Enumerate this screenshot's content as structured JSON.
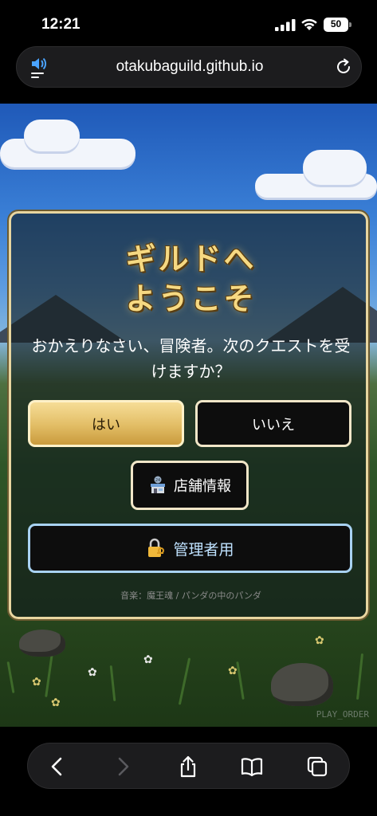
{
  "status_bar": {
    "time": "12:21",
    "battery": "50"
  },
  "browser": {
    "url": "otakubaguild.github.io"
  },
  "game": {
    "title_line1": "ギルドへ",
    "title_line2": "ようこそ",
    "prompt": "おかえりなさい、冒険者。次のクエストを受けますか？",
    "yes_label": "はい",
    "no_label": "いいえ",
    "store_label": "店舗情報",
    "admin_label": "管理者用",
    "credit": "音楽：魔王魂 / パンダの中のパンダ",
    "watermark": "PLAY_ORDER"
  },
  "colors": {
    "accent_gold": "#e2bd65",
    "admin_border": "#a8d2f2",
    "title_gold": "#f6d982"
  },
  "icons": {
    "audio": "speaker-wave-icon",
    "reload": "reload-icon",
    "store": "24h-store-icon",
    "admin": "lock-key-icon",
    "back": "chevron-left-icon",
    "forward": "chevron-right-icon",
    "share": "share-icon",
    "bookmarks": "book-icon",
    "tabs": "tabs-icon"
  }
}
